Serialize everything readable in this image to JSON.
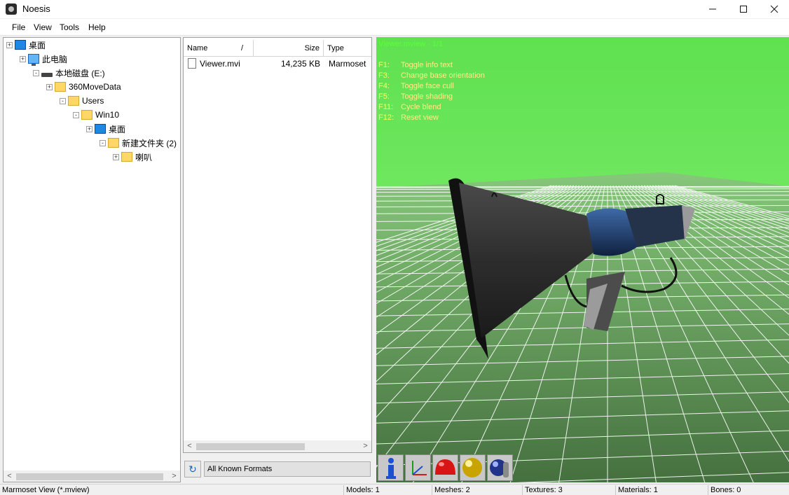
{
  "window": {
    "title": "Noesis",
    "icon": "noesis-app-icon"
  },
  "menu": [
    "File",
    "View",
    "Tools",
    "Help"
  ],
  "tree": [
    {
      "label": "桌面",
      "icon": "desktop-icon",
      "depth": 0,
      "expander": "+"
    },
    {
      "label": "此电脑",
      "icon": "computer-icon",
      "depth": 1,
      "expander": "+"
    },
    {
      "label": "本地磁盘 (E:)",
      "icon": "drive-icon",
      "depth": 2,
      "expander": "-"
    },
    {
      "label": "360MoveData",
      "icon": "folder-icon",
      "depth": 3,
      "expander": "+"
    },
    {
      "label": "Users",
      "icon": "folder-icon",
      "depth": 4,
      "expander": "-"
    },
    {
      "label": "Win10",
      "icon": "folder-icon",
      "depth": 5,
      "expander": "-"
    },
    {
      "label": "桌面",
      "icon": "desktop-icon",
      "depth": 6,
      "expander": "+"
    },
    {
      "label": "新建文件夹 (2)",
      "icon": "folder-icon",
      "depth": 7,
      "expander": "-"
    },
    {
      "label": "喇叭",
      "icon": "folder-icon",
      "depth": 8,
      "expander": "+"
    }
  ],
  "file_list": {
    "columns": {
      "name": "Name",
      "size": "Size",
      "type": "Type",
      "sort_glyph": "/"
    },
    "rows": [
      {
        "name": "Viewer.mvi",
        "size": "14,235 KB",
        "type": "Marmoset"
      }
    ]
  },
  "format_filter": {
    "value": "All Known Formats",
    "refresh_glyph": "↻"
  },
  "viewport": {
    "title": "Viewer.mview - 1/1",
    "help": [
      {
        "key": "F1:",
        "action": "Toggle info text"
      },
      {
        "key": "F3:",
        "action": "Change base orientation"
      },
      {
        "key": "F4:",
        "action": "Toggle face cull"
      },
      {
        "key": "F5:",
        "action": "Toggle shading"
      },
      {
        "key": "F11:",
        "action": "Cycle blend"
      },
      {
        "key": "F12:",
        "action": "Reset view"
      }
    ],
    "sky_color": "#63e353",
    "ground_color": "#4c7a47",
    "toolbar": [
      "info-icon",
      "axes-icon",
      "red-dome-icon",
      "gold-sphere-icon",
      "blue-sphere-icon"
    ]
  },
  "status": {
    "format": "Marmoset View (*.mview)",
    "models": "Models: 1",
    "meshes": "Meshes: 2",
    "textures": "Textures: 3",
    "materials": "Materials: 1",
    "bones": "Bones: 0"
  }
}
